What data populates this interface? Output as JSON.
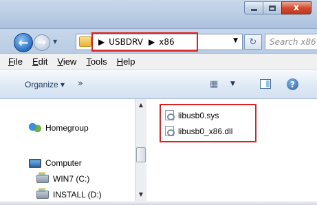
{
  "window": {
    "close_label": "x"
  },
  "navbar": {
    "back_label": "←",
    "forward_label": "→",
    "breadcrumbs": [
      "USBDRV",
      "x86"
    ],
    "search_placeholder": "Search x86"
  },
  "menu": {
    "items": [
      "File",
      "Edit",
      "View",
      "Tools",
      "Help"
    ]
  },
  "commandbar": {
    "organize_label": "Organize ▾",
    "more_label": "»"
  },
  "navpane": {
    "items": [
      {
        "label": "Homegroup",
        "icon": "homegroup-icon"
      },
      {
        "label": "Computer",
        "icon": "computer-icon"
      },
      {
        "label": "WIN7 (C:)",
        "icon": "drive-icon"
      },
      {
        "label": "INSTALL (D:)",
        "icon": "drive-icon"
      }
    ]
  },
  "files": [
    {
      "name": "libusb0.sys",
      "icon": "system-file-icon"
    },
    {
      "name": "libusb0_x86.dll",
      "icon": "dll-file-icon"
    }
  ],
  "colors": {
    "highlight": "#e0201e"
  }
}
